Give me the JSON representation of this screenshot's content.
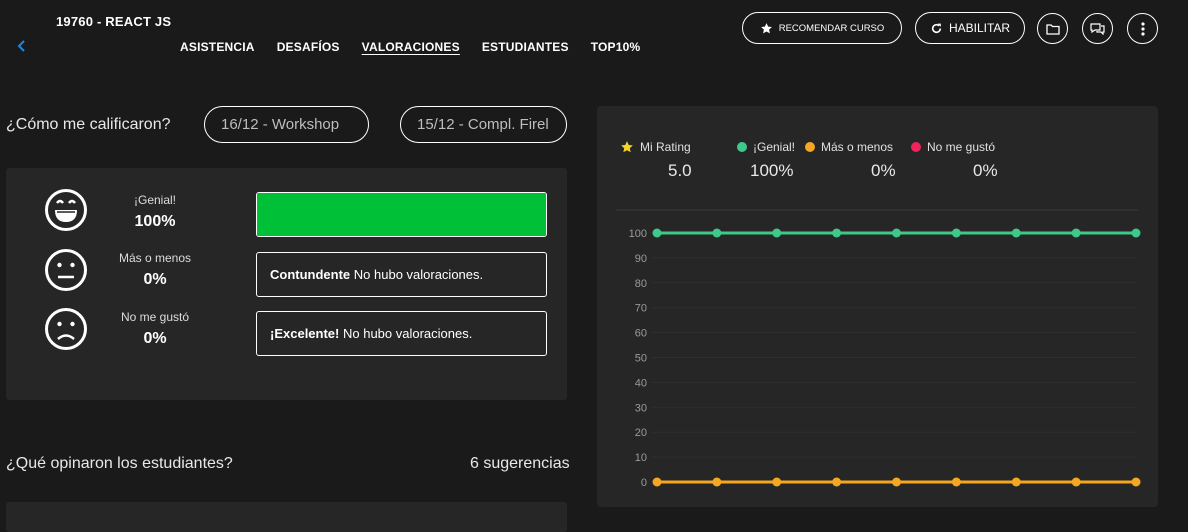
{
  "header": {
    "course_code": "19760 - REACT JS",
    "nav": [
      {
        "label": "ASISTENCIA",
        "active": false
      },
      {
        "label": "DESAFÍOS",
        "active": false
      },
      {
        "label": "VALORACIONES",
        "active": true
      },
      {
        "label": "ESTUDIANTES",
        "active": false
      },
      {
        "label": "TOP10%",
        "active": false
      }
    ],
    "recommend_label": "RECOMENDAR CURSO",
    "enable_label": "HABILITAR",
    "icons": [
      "chevron-left-icon",
      "star-icon",
      "refresh-icon",
      "folder-icon",
      "chat-icon",
      "more-vertical-icon"
    ]
  },
  "ratings": {
    "question": "¿Cómo me calificaron?",
    "chips": [
      "16/12 - Workshop",
      "15/12 - Compl. Firel"
    ],
    "rows": [
      {
        "label": "¡Genial!",
        "pct": "100%",
        "fill": 1.0,
        "face": "grin-face-icon"
      },
      {
        "label": "Más o menos",
        "pct": "0%",
        "fill": 0,
        "face": "neutral-face-icon",
        "box_bold": "Contundente",
        "box_text": " No hubo valoraciones."
      },
      {
        "label": "No me gustó",
        "pct": "0%",
        "fill": 0,
        "face": "sad-face-icon",
        "box_bold": "¡Excelente!",
        "box_text": " No hubo valoraciones."
      }
    ],
    "accent": "#00c037"
  },
  "opinions": {
    "question": "¿Qué opinaron los estudiantes?",
    "count": "6 sugerencias"
  },
  "legend": {
    "my_rating_label": "Mi Rating",
    "my_rating_value": "5.0",
    "genial_label": "¡Genial!",
    "genial_value": "100%",
    "mas_label": "Más o menos",
    "mas_value": "0%",
    "no_label": "No me gustó",
    "no_value": "0%",
    "colors": {
      "star": "#f5d327",
      "genial": "#3ec98a",
      "mas": "#f5a623",
      "no": "#f0245a"
    }
  },
  "chart_data": {
    "type": "line",
    "x": [
      1,
      2,
      3,
      4,
      5,
      6,
      7,
      8,
      9
    ],
    "yticks": [
      0,
      10,
      20,
      30,
      40,
      50,
      60,
      70,
      80,
      90,
      100
    ],
    "ylim": [
      0,
      100
    ],
    "series": [
      {
        "name": "¡Genial!",
        "color": "#3ec98a",
        "values": [
          100,
          100,
          100,
          100,
          100,
          100,
          100,
          100,
          100
        ]
      },
      {
        "name": "Más o menos",
        "color": "#f5a623",
        "values": [
          0,
          0,
          0,
          0,
          0,
          0,
          0,
          0,
          0
        ]
      }
    ]
  }
}
